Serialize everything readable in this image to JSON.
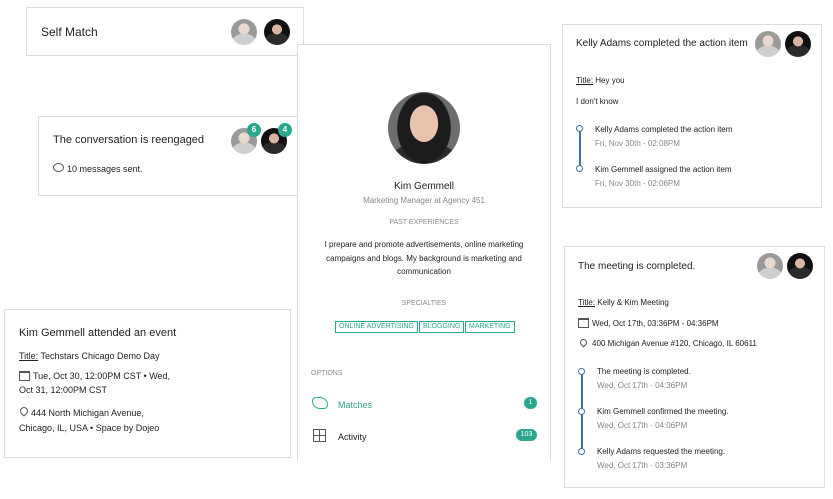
{
  "self_match": {
    "title": "Self Match"
  },
  "reengaged": {
    "title": "The conversation is reengaged",
    "badge_1": "6",
    "badge_2": "4",
    "messages": "10 messages sent."
  },
  "event": {
    "heading": "Kim Gemmell attended an event",
    "title_label": "Title:",
    "title_value": "Techstars Chicago Demo Day",
    "date_line1": "Tue, Oct 30, 12:00PM CST • Wed,",
    "date_line2": "Oct 31, 12:00PM CST",
    "address_line1": "444 North Michigan Avenue,",
    "address_line2": "Chicago, IL, USA • Space by Dojeo"
  },
  "profile": {
    "name": "Kim Gemmell",
    "role": "Marketing Manager at Agency 451",
    "past_heading": "PAST EXPERIENCES",
    "bio_1": "I prepare and promote advertisements, online marketing",
    "bio_2": "campaigns and blogs. My background is marketing and",
    "bio_3": "communication",
    "specialties_heading": "SPECIALTIES",
    "tags": [
      "ONLINE ADVERTISING",
      "BLOGGING",
      "MARKETING"
    ],
    "options_heading": "OPTIONS",
    "options": [
      {
        "label": "Matches",
        "count": "1"
      },
      {
        "label": "Activity",
        "count": "103"
      }
    ],
    "accent": "#2aa78f"
  },
  "action_item": {
    "heading": "Kelly Adams completed the action item",
    "title_label": "Title:",
    "title_value": "Hey you",
    "body": "I don't know",
    "timeline": [
      {
        "text": "Kelly Adams completed the action item",
        "time": "Fri, Nov 30th - 02:08PM"
      },
      {
        "text": "Kim Gemmell assigned the action item",
        "time": "Fri, Nov 30th - 02:06PM"
      }
    ]
  },
  "meeting": {
    "heading": "The meeting is completed.",
    "title_label": "Title:",
    "title_value": "Kelly & Kim Meeting",
    "date": "Wed, Oct 17th, 03:36PM - 04:36PM",
    "address": "400 Michigan Avenue #120, Chicago, IL 60611",
    "timeline": [
      {
        "text": "The meeting is completed.",
        "time": "Wed, Oct 17th - 04:36PM"
      },
      {
        "text": "Kim Gemmell confirmed the meeting.",
        "time": "Wed, Oct 17th - 04:06PM"
      },
      {
        "text": "Kelly Adams requested the meeting.",
        "time": "Wed, Oct 17th - 03:36PM"
      }
    ]
  }
}
